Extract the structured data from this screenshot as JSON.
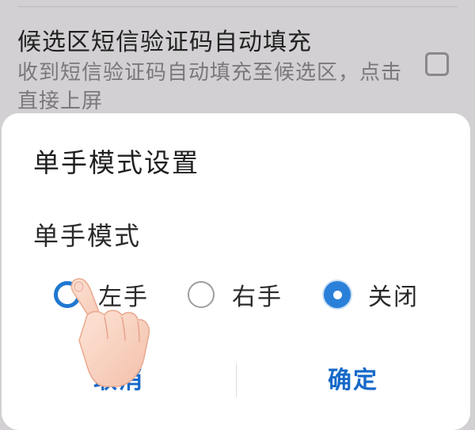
{
  "background": {
    "title": "候选区短信验证码自动填充",
    "description": "收到短信验证码自动填充至候选区，点击直接上屏",
    "checked": false
  },
  "dialog": {
    "title": "单手模式设置",
    "section_label": "单手模式",
    "options": [
      {
        "label": "左手",
        "state": "pressed"
      },
      {
        "label": "右手",
        "state": "unchecked"
      },
      {
        "label": "关闭",
        "state": "checked"
      }
    ],
    "selected_option": "关闭",
    "cancel_label": "取消",
    "confirm_label": "确定"
  },
  "colors": {
    "accent": "#1769c8",
    "radio_checked": "#2a80d8",
    "overlay": "#d2d0d2"
  },
  "icons": {
    "gesture": "finger-tap-icon"
  }
}
